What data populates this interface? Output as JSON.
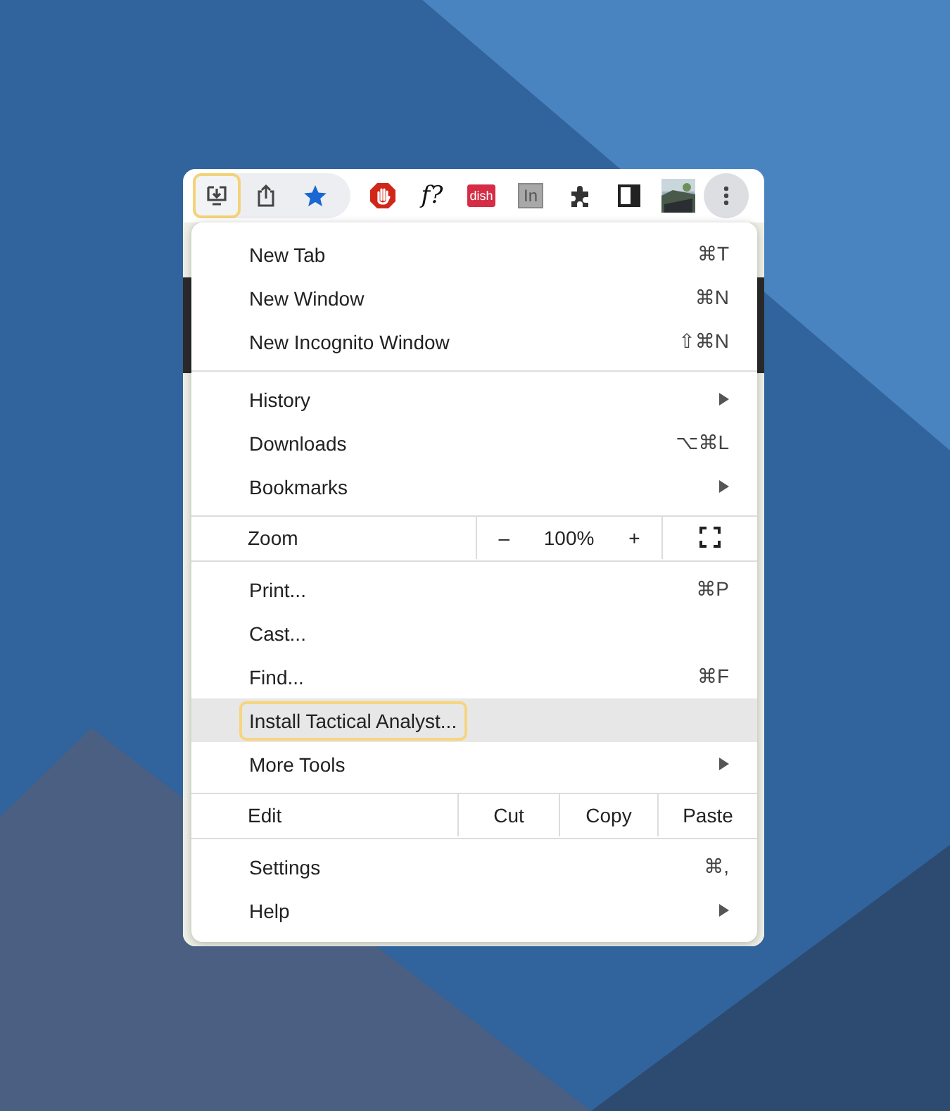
{
  "toolbar": {
    "items": [
      {
        "kind": "download",
        "focused": true
      },
      {
        "kind": "share",
        "focused": false
      },
      {
        "kind": "star",
        "focused": false
      },
      {
        "kind": "stop-hand",
        "focused": false
      },
      {
        "kind": "text",
        "label": "f?",
        "focused": false
      },
      {
        "kind": "badge",
        "label": "dish",
        "focused": false
      },
      {
        "kind": "box",
        "label": "In",
        "focused": false
      },
      {
        "kind": "puzzle",
        "focused": false
      },
      {
        "kind": "sidebar",
        "focused": false
      },
      {
        "kind": "avatar",
        "focused": false
      },
      {
        "kind": "more",
        "focused": false
      }
    ]
  },
  "menu": {
    "sections": [
      [
        {
          "kind": "item",
          "label": "New Tab",
          "shortcut": "⌘T",
          "submenu": false,
          "highlighted": false,
          "focused": false
        },
        {
          "kind": "item",
          "label": "New Window",
          "shortcut": "⌘N",
          "submenu": false,
          "highlighted": false,
          "focused": false
        },
        {
          "kind": "item",
          "label": "New Incognito Window",
          "shortcut": "⇧⌘N",
          "submenu": false,
          "highlighted": false,
          "focused": false
        }
      ],
      [
        {
          "kind": "item",
          "label": "History",
          "submenu": true,
          "highlighted": false,
          "focused": false
        },
        {
          "kind": "item",
          "label": "Downloads",
          "shortcut": "⌥⌘L",
          "submenu": false,
          "highlighted": false,
          "focused": false
        },
        {
          "kind": "item",
          "label": "Bookmarks",
          "submenu": true,
          "highlighted": false,
          "focused": false
        }
      ],
      [
        {
          "kind": "zoom",
          "label": "Zoom",
          "minus": "–",
          "value": "100%",
          "plus": "+"
        }
      ],
      [
        {
          "kind": "item",
          "label": "Print...",
          "shortcut": "⌘P",
          "submenu": false,
          "highlighted": false,
          "focused": false
        },
        {
          "kind": "item",
          "label": "Cast...",
          "submenu": false,
          "highlighted": false,
          "focused": false
        },
        {
          "kind": "item",
          "label": "Find...",
          "shortcut": "⌘F",
          "submenu": false,
          "highlighted": false,
          "focused": false
        },
        {
          "kind": "item",
          "label": "Install Tactical Analyst...",
          "submenu": false,
          "highlighted": true,
          "focused": true
        },
        {
          "kind": "item",
          "label": "More Tools",
          "submenu": true,
          "highlighted": false,
          "focused": false
        }
      ],
      [
        {
          "kind": "edit",
          "label": "Edit",
          "buttons": [
            "Cut",
            "Copy",
            "Paste"
          ]
        }
      ],
      [
        {
          "kind": "item",
          "label": "Settings",
          "shortcut": "⌘,",
          "submenu": false,
          "highlighted": false,
          "focused": false
        },
        {
          "kind": "item",
          "label": "Help",
          "submenu": true,
          "highlighted": false,
          "focused": false
        }
      ]
    ]
  }
}
